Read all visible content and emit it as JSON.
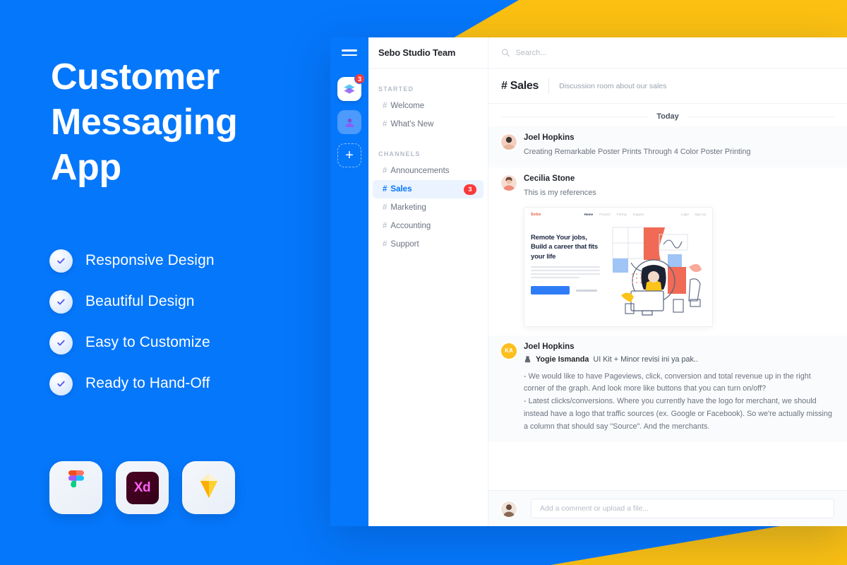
{
  "promo": {
    "title": "Customer Messaging App",
    "features": [
      {
        "label": "Responsive Design",
        "icon": "check-circle-icon"
      },
      {
        "label": "Beautiful Design",
        "icon": "check-circle-icon"
      },
      {
        "label": "Easy to Customize",
        "icon": "check-circle-icon"
      },
      {
        "label": "Ready to Hand-Off",
        "icon": "check-circle-icon"
      }
    ],
    "apps": [
      {
        "name": "Figma",
        "icon": "figma-icon"
      },
      {
        "name": "Adobe XD",
        "icon": "adobe-xd-icon",
        "label": "Xd"
      },
      {
        "name": "Sketch",
        "icon": "sketch-icon"
      }
    ],
    "colors": {
      "background": "#0577fb",
      "accent_yellow": "#fbc011",
      "text": "#ffffff"
    }
  },
  "app": {
    "rail": {
      "menu_icon": "hamburger-icon",
      "workspaces": [
        {
          "icon": "workspace-layers-icon",
          "badge": "3"
        },
        {
          "icon": "workspace-avatar-icon",
          "badge": ""
        }
      ],
      "add_label": "+"
    },
    "sidebar": {
      "team_name": "Sebo Studio Team",
      "sections": [
        {
          "title": "STARTED",
          "items": [
            {
              "hash": "#",
              "label": "Welcome",
              "badge": "",
              "active": false
            },
            {
              "hash": "#",
              "label": "What's New",
              "badge": "",
              "active": false
            }
          ]
        },
        {
          "title": "CHANNELS",
          "items": [
            {
              "hash": "#",
              "label": "Announcements",
              "badge": "",
              "active": false
            },
            {
              "hash": "#",
              "label": "Sales",
              "badge": "3",
              "active": true
            },
            {
              "hash": "#",
              "label": "Marketing",
              "badge": "",
              "active": false
            },
            {
              "hash": "#",
              "label": "Accounting",
              "badge": "",
              "active": false
            },
            {
              "hash": "#",
              "label": "Support",
              "badge": "",
              "active": false
            }
          ]
        }
      ]
    },
    "topbar": {
      "search_placeholder": "Search...",
      "search_value": "",
      "search_icon": "search-icon"
    },
    "channel_header": {
      "title": "# Sales",
      "subtitle": "Discussion room about our sales"
    },
    "conversation": {
      "day_separator": "Today",
      "messages": [
        {
          "author": "Joel Hopkins",
          "avatar_type": "photo",
          "text": "Creating Remarkable Poster Prints Through 4 Color Poster Printing",
          "shaded": true
        },
        {
          "author": "Cecilia Stone",
          "avatar_type": "photo",
          "text": "This is my references",
          "shaded": false,
          "embed": {
            "logo": "Sebo",
            "nav": [
              "Home",
              "Product",
              "Pricing",
              "Support"
            ],
            "nav_right": [
              "Login",
              "Sign Up"
            ],
            "heading": "Remote Your jobs, Build a career that fits your life",
            "cta_label": "",
            "link_label": ""
          }
        },
        {
          "author": "Joel Hopkins",
          "avatar_type": "initials",
          "avatar_initials": "KA",
          "avatar_color": "#fcbf1e",
          "shaded": true,
          "sub_author": "Yogie Ismanda",
          "sub_text": "UI Kit + Minor revisi ini ya pak..",
          "sub_icon": "stamp-icon",
          "paragraphs": [
            "- We would like to have Pageviews, click, conversion and total revenue up in the right corner of the graph. And look more like buttons that you can turn on/off?",
            "- Latest clicks/conversions. Where you currently have the logo for merchant, we should instead have a logo that traffic sources (ex. Google or Facebook). So we're actually missing a column that should say \"Source\". And the merchants."
          ]
        }
      ]
    },
    "composer": {
      "placeholder": "Add a comment or upload a file...",
      "value": "",
      "avatar_type": "photo"
    },
    "colors": {
      "primary": "#0577fb",
      "active_channel_bg": "#eaf3ff",
      "badge_red": "#f93a3a",
      "initials_avatar": "#fcbf1e"
    }
  }
}
